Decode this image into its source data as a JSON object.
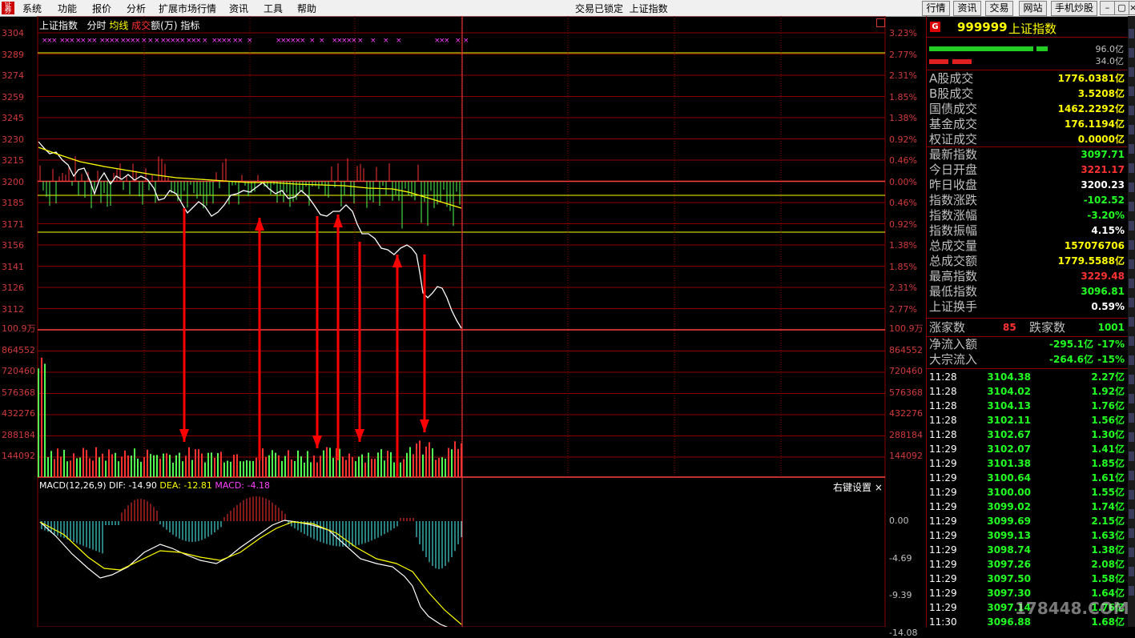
{
  "menu": {
    "logo": "证券",
    "items": [
      "系统",
      "功能",
      "报价",
      "分析",
      "扩展市场行情",
      "资讯",
      "工具",
      "帮助"
    ],
    "status": "交易已锁定",
    "index_name": "上证指数",
    "buttons": [
      "行情",
      "资讯",
      "交易",
      "网站",
      "手机炒股"
    ],
    "window_controls": [
      "minimize-icon",
      "restore-icon",
      "close-icon"
    ]
  },
  "chart": {
    "header": {
      "title": "上证指数",
      "tabs": [
        "分时",
        "均线",
        "成交",
        "额(万)",
        "指标"
      ]
    },
    "price_axis_left": [
      "3304",
      "3289",
      "3274",
      "3259",
      "3245",
      "3230",
      "3215",
      "3200",
      "3185",
      "3171",
      "3156",
      "3141",
      "3126",
      "3112"
    ],
    "price_axis_right": [
      "3.23%",
      "2.77%",
      "2.31%",
      "1.85%",
      "1.38%",
      "0.92%",
      "0.46%",
      "0.00%",
      "0.46%",
      "0.92%",
      "1.38%",
      "1.85%",
      "2.31%",
      "2.77%"
    ],
    "volume_axis": [
      "100.9万",
      "864552",
      "720460",
      "576368",
      "432276",
      "288184",
      "144092"
    ],
    "macd_axis": [
      "0.00",
      "-4.69",
      "-9.39",
      "-14.08"
    ],
    "macd_label": "MACD(12,26,9)",
    "dif_label": "DIF: -14.90",
    "dea_label": "DEA: -12.81",
    "macd_value": "MACD: -4.18",
    "right_settings": "右键设置",
    "close_x": "×",
    "colors": {
      "up": "#ff3232",
      "down": "#54ff54",
      "grid": "#8b0000",
      "price": "#ffffff",
      "avg": "#ffff00",
      "macd_neg": "#54ffff",
      "arrow": "#ff0000"
    }
  },
  "panel": {
    "badge": "G",
    "code": "999999",
    "name": "上证指数",
    "bar_pct": [
      "96.0亿",
      "34.0亿"
    ],
    "stats": [
      {
        "label": "A股成交",
        "value": "1776.0381亿",
        "color": "#ffff00"
      },
      {
        "label": "B股成交",
        "value": "3.5208亿",
        "color": "#ffff00"
      },
      {
        "label": "国债成交",
        "value": "1462.2292亿",
        "color": "#ffff00"
      },
      {
        "label": "基金成交",
        "value": "176.1194亿",
        "color": "#ffff00"
      },
      {
        "label": "权证成交",
        "value": "0.0000亿",
        "color": "#ffff00"
      },
      {
        "label": "最新指数",
        "value": "3097.71",
        "color": "#22ff22"
      },
      {
        "label": "今日开盘",
        "value": "3221.17",
        "color": "#ff3232"
      },
      {
        "label": "昨日收盘",
        "value": "3200.23",
        "color": "#ffffff"
      },
      {
        "label": "指数涨跌",
        "value": "-102.52",
        "color": "#22ff22"
      },
      {
        "label": "指数涨幅",
        "value": "-3.20%",
        "color": "#22ff22"
      },
      {
        "label": "指数振幅",
        "value": "4.15%",
        "color": "#ffffff"
      },
      {
        "label": "总成交量",
        "value": "157076706",
        "color": "#ffff00"
      },
      {
        "label": "总成交额",
        "value": "1779.5588亿",
        "color": "#ffff00"
      },
      {
        "label": "最高指数",
        "value": "3229.48",
        "color": "#ff3232"
      },
      {
        "label": "最低指数",
        "value": "3096.81",
        "color": "#22ff22"
      },
      {
        "label": "上证换手",
        "value": "0.59%",
        "color": "#ffffff"
      }
    ],
    "breadth": {
      "up_label": "涨家数",
      "up_value": "85",
      "down_label": "跌家数",
      "down_value": "1001"
    },
    "flows": [
      {
        "label": "净流入额",
        "value": "-295.1亿",
        "pct": "-17%"
      },
      {
        "label": "大宗流入",
        "value": "-264.6亿",
        "pct": "-15%"
      }
    ],
    "ticks": [
      {
        "time": "11:28",
        "price": "3104.38",
        "amt": "2.27亿"
      },
      {
        "time": "11:28",
        "price": "3104.02",
        "amt": "1.92亿"
      },
      {
        "time": "11:28",
        "price": "3104.13",
        "amt": "1.76亿"
      },
      {
        "time": "11:28",
        "price": "3102.11",
        "amt": "1.56亿"
      },
      {
        "time": "11:28",
        "price": "3102.67",
        "amt": "1.30亿"
      },
      {
        "time": "11:29",
        "price": "3102.07",
        "amt": "1.41亿"
      },
      {
        "time": "11:29",
        "price": "3101.38",
        "amt": "1.85亿"
      },
      {
        "time": "11:29",
        "price": "3100.64",
        "amt": "1.61亿"
      },
      {
        "time": "11:29",
        "price": "3100.00",
        "amt": "1.55亿"
      },
      {
        "time": "11:29",
        "price": "3099.02",
        "amt": "1.74亿"
      },
      {
        "time": "11:29",
        "price": "3099.69",
        "amt": "2.15亿"
      },
      {
        "time": "11:29",
        "price": "3099.13",
        "amt": "1.63亿"
      },
      {
        "time": "11:29",
        "price": "3098.74",
        "amt": "1.38亿"
      },
      {
        "time": "11:29",
        "price": "3097.26",
        "amt": "2.08亿"
      },
      {
        "time": "11:29",
        "price": "3097.50",
        "amt": "1.58亿"
      },
      {
        "time": "11:29",
        "price": "3097.30",
        "amt": "1.64亿"
      },
      {
        "time": "11:29",
        "price": "3097.14",
        "amt": "1.76亿"
      },
      {
        "time": "11:30",
        "price": "3096.88",
        "amt": "1.68亿"
      }
    ]
  },
  "watermark": "178448.COM"
}
